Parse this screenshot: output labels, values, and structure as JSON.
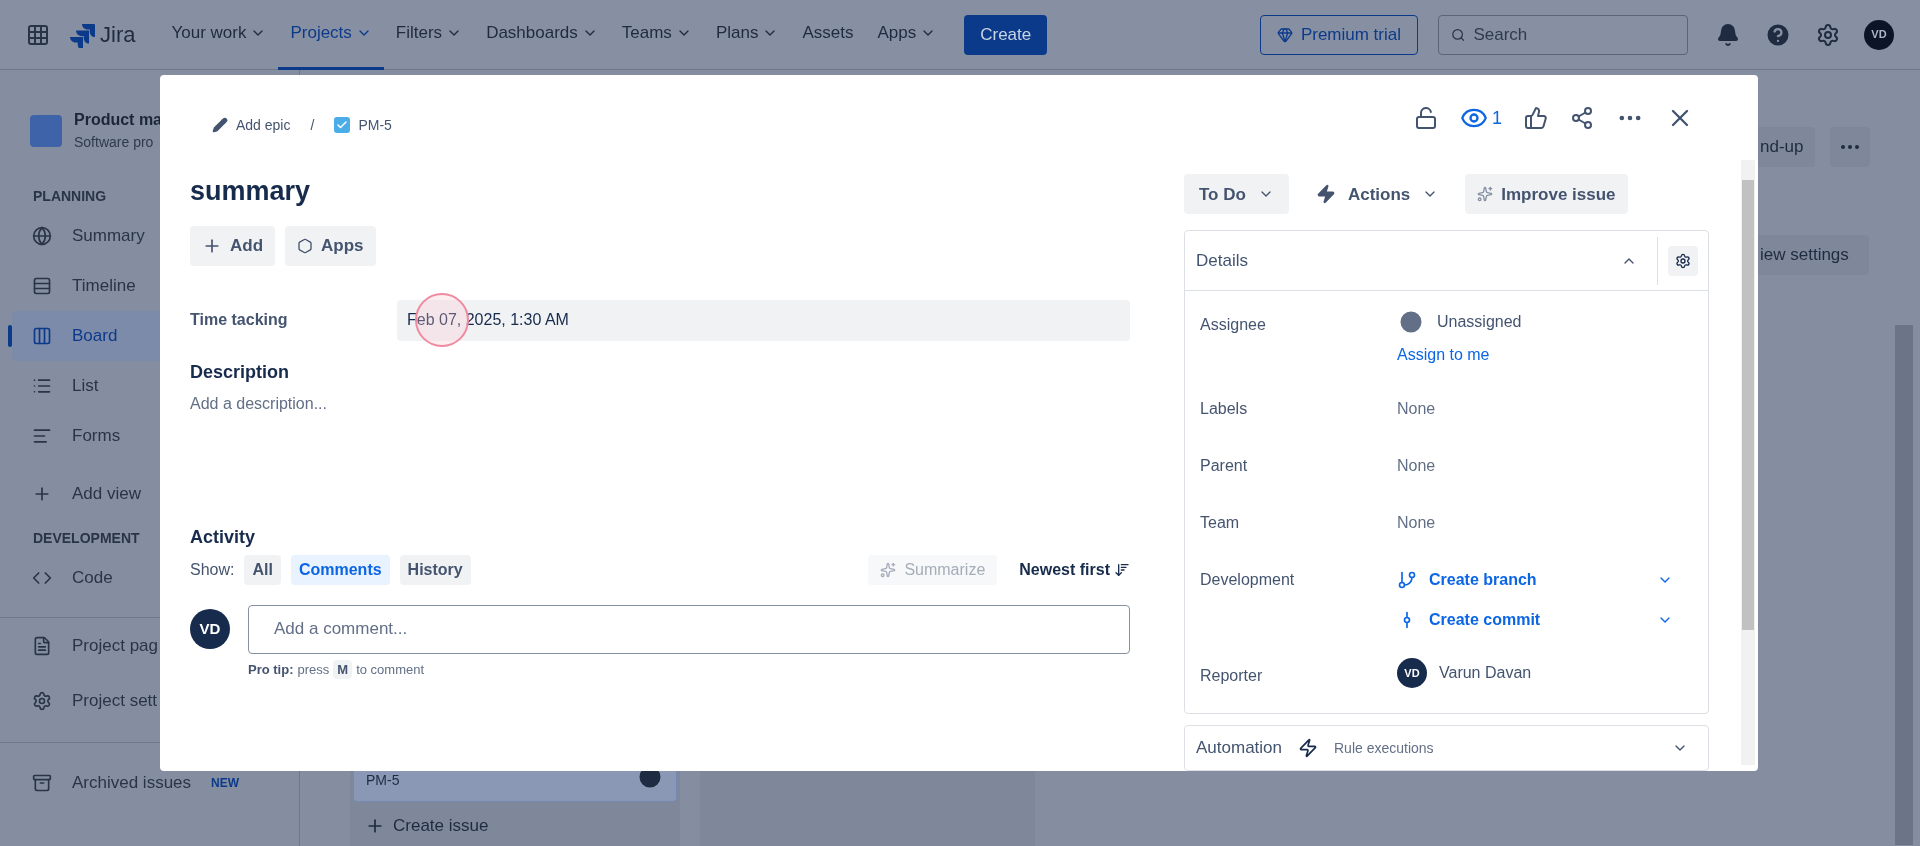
{
  "nav": {
    "product": "Jira",
    "items": [
      {
        "label": "Your work",
        "selected": false,
        "dropdown": true
      },
      {
        "label": "Projects",
        "selected": true,
        "dropdown": true
      },
      {
        "label": "Filters",
        "selected": false,
        "dropdown": true
      },
      {
        "label": "Dashboards",
        "selected": false,
        "dropdown": true
      },
      {
        "label": "Teams",
        "selected": false,
        "dropdown": true
      },
      {
        "label": "Plans",
        "selected": false,
        "dropdown": true
      },
      {
        "label": "Assets",
        "selected": false,
        "dropdown": false
      },
      {
        "label": "Apps",
        "selected": false,
        "dropdown": true
      }
    ],
    "create": "Create",
    "premium": "Premium trial",
    "search": {
      "placeholder": "Search"
    },
    "avatar": "VD"
  },
  "sidebar": {
    "project": {
      "name": "Product ma",
      "type": "Software pro"
    },
    "sections": [
      {
        "heading": "PLANNING",
        "items": [
          {
            "kind": "summary",
            "label": "Summary",
            "selected": false
          },
          {
            "kind": "timeline",
            "label": "Timeline",
            "selected": false
          },
          {
            "kind": "board",
            "label": "Board",
            "selected": true
          },
          {
            "kind": "list",
            "label": "List",
            "selected": false
          },
          {
            "kind": "forms",
            "label": "Forms",
            "selected": false
          },
          {
            "kind": "add",
            "label": "Add view",
            "selected": false
          }
        ]
      },
      {
        "heading": "DEVELOPMENT",
        "items": [
          {
            "kind": "code",
            "label": "Code",
            "selected": false
          }
        ]
      },
      {
        "items": [
          {
            "kind": "page",
            "label": "Project pag",
            "selected": false
          },
          {
            "kind": "settings",
            "label": "Project sett",
            "selected": false
          }
        ]
      },
      {
        "items": [
          {
            "kind": "archive",
            "label": "Archived issues",
            "badge": "NEW",
            "selected": false
          }
        ]
      }
    ]
  },
  "board": {
    "header_buttons": [
      "nd-up"
    ],
    "view_settings": "iew settings",
    "card": {
      "key": "PM-5"
    },
    "create_issue": "Create issue"
  },
  "modal": {
    "breadcrumbs": [
      "Add epic",
      "PM-5"
    ],
    "separator": "/",
    "watchers": "1",
    "title": "summary",
    "buttons": [
      "Add",
      "Apps"
    ],
    "fields": [
      {
        "label": "Time tacking",
        "value": "Feb 07, 2025, 1:30 AM"
      }
    ],
    "description": {
      "label": "Description",
      "placeholder": "Add a description..."
    },
    "activity": {
      "title": "Activity",
      "show": "Show:",
      "filters": [
        {
          "label": "All",
          "selected": false
        },
        {
          "label": "Comments",
          "selected": true
        },
        {
          "label": "History",
          "selected": false
        }
      ],
      "summarize": "Summarize",
      "sort": "Newest first",
      "avatar": "VD",
      "comment": {
        "placeholder": "Add a comment..."
      },
      "tip": {
        "bold": "Pro tip:",
        "press": "press",
        "key": "M",
        "rest": "to comment"
      }
    },
    "status": "To Do",
    "actions": "Actions",
    "improve": "Improve issue",
    "details": {
      "title": "Details",
      "expanded": true,
      "rows": [
        {
          "kind": "person",
          "label": "Assignee",
          "value": "Unassigned",
          "link": "Assign to me"
        },
        {
          "kind": "text",
          "label": "Labels",
          "value": "None"
        },
        {
          "kind": "text",
          "label": "Parent",
          "value": "None"
        },
        {
          "kind": "text",
          "label": "Team",
          "value": "None"
        },
        {
          "kind": "dev",
          "label": "Development",
          "links": [
            "Create branch",
            "Create commit"
          ]
        },
        {
          "kind": "avatar",
          "label": "Reporter",
          "value": "Varun Davan",
          "avatar": "VD"
        }
      ]
    },
    "automation": {
      "title": "Automation",
      "subtitle": "Rule executions"
    }
  }
}
